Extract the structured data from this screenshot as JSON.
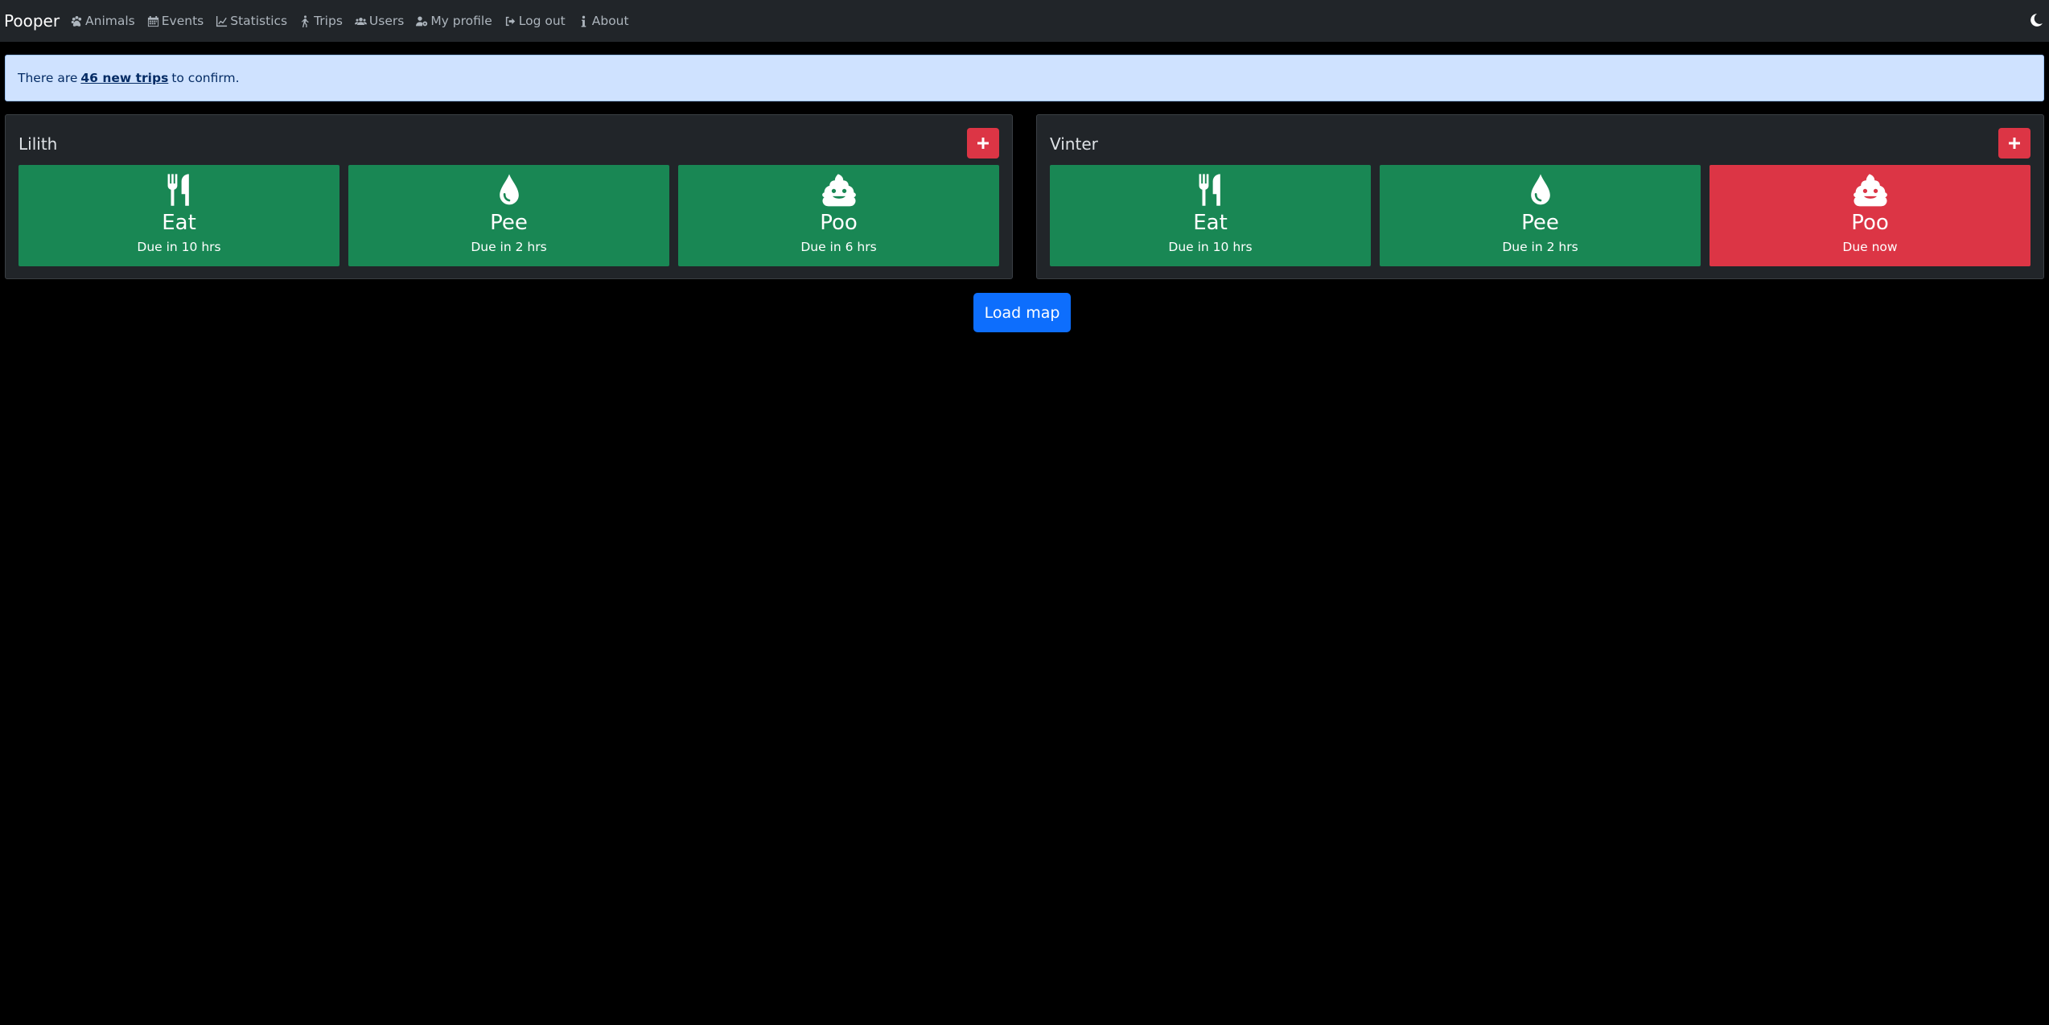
{
  "navbar": {
    "brand": "Pooper",
    "items": [
      {
        "label": "Animals",
        "icon": "paw-icon"
      },
      {
        "label": "Events",
        "icon": "calendar-icon"
      },
      {
        "label": "Statistics",
        "icon": "chart-line-icon"
      },
      {
        "label": "Trips",
        "icon": "person-walking-icon"
      },
      {
        "label": "Users",
        "icon": "users-icon"
      },
      {
        "label": "My profile",
        "icon": "user-gear-icon"
      },
      {
        "label": "Log out",
        "icon": "sign-out-icon"
      },
      {
        "label": "About",
        "icon": "info-icon"
      }
    ],
    "theme_icon": "moon-icon"
  },
  "alert": {
    "prefix": "There are",
    "link": "46 new trips",
    "suffix": "to confirm."
  },
  "animals": [
    {
      "name": "Lilith",
      "tiles": [
        {
          "title": "Eat",
          "due": "Due in 10 hrs",
          "icon": "utensils-icon",
          "status": "ok"
        },
        {
          "title": "Pee",
          "due": "Due in 2 hrs",
          "icon": "droplet-icon",
          "status": "ok"
        },
        {
          "title": "Poo",
          "due": "Due in 6 hrs",
          "icon": "poo-icon",
          "status": "ok"
        }
      ]
    },
    {
      "name": "Vinter",
      "tiles": [
        {
          "title": "Eat",
          "due": "Due in 10 hrs",
          "icon": "utensils-icon",
          "status": "ok"
        },
        {
          "title": "Pee",
          "due": "Due in 2 hrs",
          "icon": "droplet-icon",
          "status": "ok"
        },
        {
          "title": "Poo",
          "due": "Due now",
          "icon": "poo-icon",
          "status": "due"
        }
      ]
    }
  ],
  "load_map_label": "Load map",
  "colors": {
    "ok": "#198754",
    "due": "#dc3545",
    "primary": "#0d6efd",
    "alert_bg": "#cfe2ff"
  }
}
